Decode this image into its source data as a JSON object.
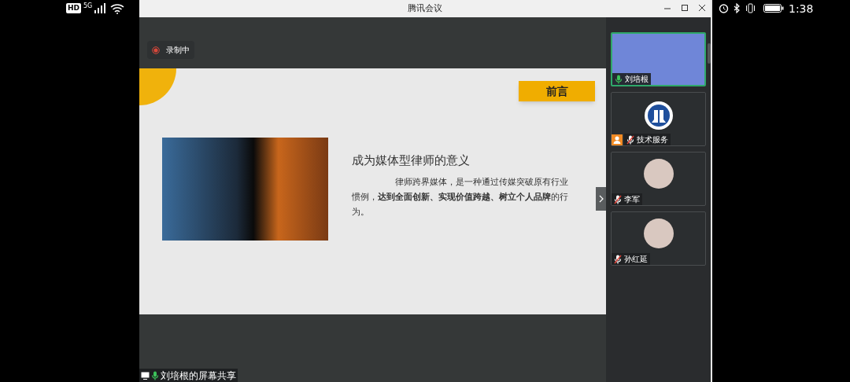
{
  "status_bar": {
    "network_badges": [
      "HD",
      "5G"
    ],
    "time": "1:38"
  },
  "window": {
    "title": "腾讯会议"
  },
  "recording": {
    "label": "录制中"
  },
  "slide": {
    "tag": "前言",
    "heading": "成为媒体型律师的意义",
    "paragraph": "律师跨界媒体，是一种通过传媒突破原有行业惯例，**达到全面创新、实现价值跨越、树立个人品牌**的行为。"
  },
  "screen_share_label": "刘培根的屏幕共享",
  "participants": [
    {
      "name": "刘培根",
      "kind": "video",
      "speaking": true,
      "muted": false,
      "host": false
    },
    {
      "name": "技术服务",
      "kind": "logo",
      "speaking": false,
      "muted": true,
      "host": true
    },
    {
      "name": "李军",
      "kind": "avatar",
      "speaking": false,
      "muted": true,
      "host": false
    },
    {
      "name": "孙红延",
      "kind": "avatar",
      "speaking": false,
      "muted": true,
      "host": false
    }
  ]
}
